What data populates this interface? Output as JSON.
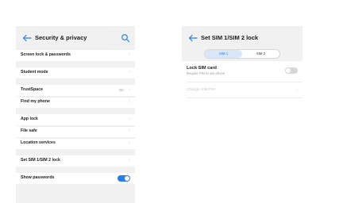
{
  "left": {
    "title": "Security & privacy",
    "items": [
      {
        "label": "Screen lock & passwords",
        "value": "",
        "control": "chevron"
      },
      {
        "label": "Student mode",
        "value": "",
        "control": "chevron"
      },
      {
        "label": "TrustSpace",
        "value": "On",
        "control": "chevron"
      },
      {
        "label": "Find my phone",
        "value": "",
        "control": "chevron"
      },
      {
        "label": "App lock",
        "value": "",
        "control": "chevron"
      },
      {
        "label": "File safe",
        "value": "",
        "control": "chevron"
      },
      {
        "label": "Location services",
        "value": "",
        "control": "chevron"
      },
      {
        "label": "Set SIM 1/SIM 2 lock",
        "value": "",
        "control": "chevron"
      },
      {
        "label": "Show passwords",
        "value": "",
        "control": "toggle",
        "on": true
      }
    ]
  },
  "right": {
    "title": "Set SIM 1/SIM 2 lock",
    "tabs": [
      "SIM 1",
      "SIM 2"
    ],
    "selected_tab": "SIM 1",
    "lock_sim": {
      "title": "Lock SIM card",
      "subtitle": "Require PIN to use phone",
      "on": false
    },
    "change_pin": "Change SIM PIN"
  },
  "colors": {
    "accent": "#2a7ce6",
    "background": "#f1f1f1",
    "card": "#ffffff"
  }
}
